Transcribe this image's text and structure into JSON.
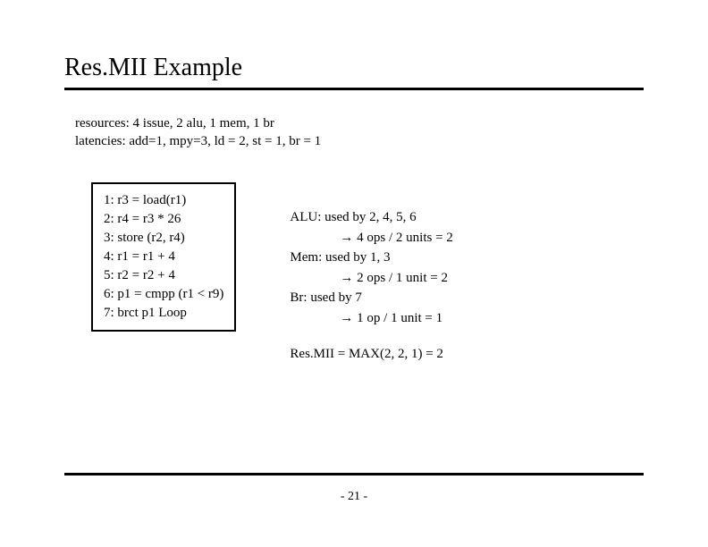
{
  "title": "Res.MII Example",
  "meta": {
    "resources": "resources: 4 issue, 2 alu, 1 mem, 1 br",
    "latencies": "latencies: add=1, mpy=3, ld = 2, st = 1, br = 1"
  },
  "code": {
    "l1": "1: r3 = load(r1)",
    "l2": "2: r4 = r3 * 26",
    "l3": "3: store (r2, r4)",
    "l4": "4: r1 = r1 + 4",
    "l5": "5: r2 = r2 + 4",
    "l6": "6: p1 = cmpp (r1 < r9)",
    "l7": "7: brct p1 Loop"
  },
  "calc": {
    "alu_label": "ALU:  used by 2, 4, 5, 6",
    "alu_math_prefix": " 4 ops / 2 units = 2",
    "mem_label": "Mem: used by 1, 3",
    "mem_math_prefix": " 2 ops / 1 unit = 2",
    "br_label": "Br: used by 7",
    "br_math_prefix": " 1 op / 1 unit = 1",
    "result": "Res.MII = MAX(2, 2, 1) = 2"
  },
  "arrow": "→",
  "page": "- 21 -"
}
